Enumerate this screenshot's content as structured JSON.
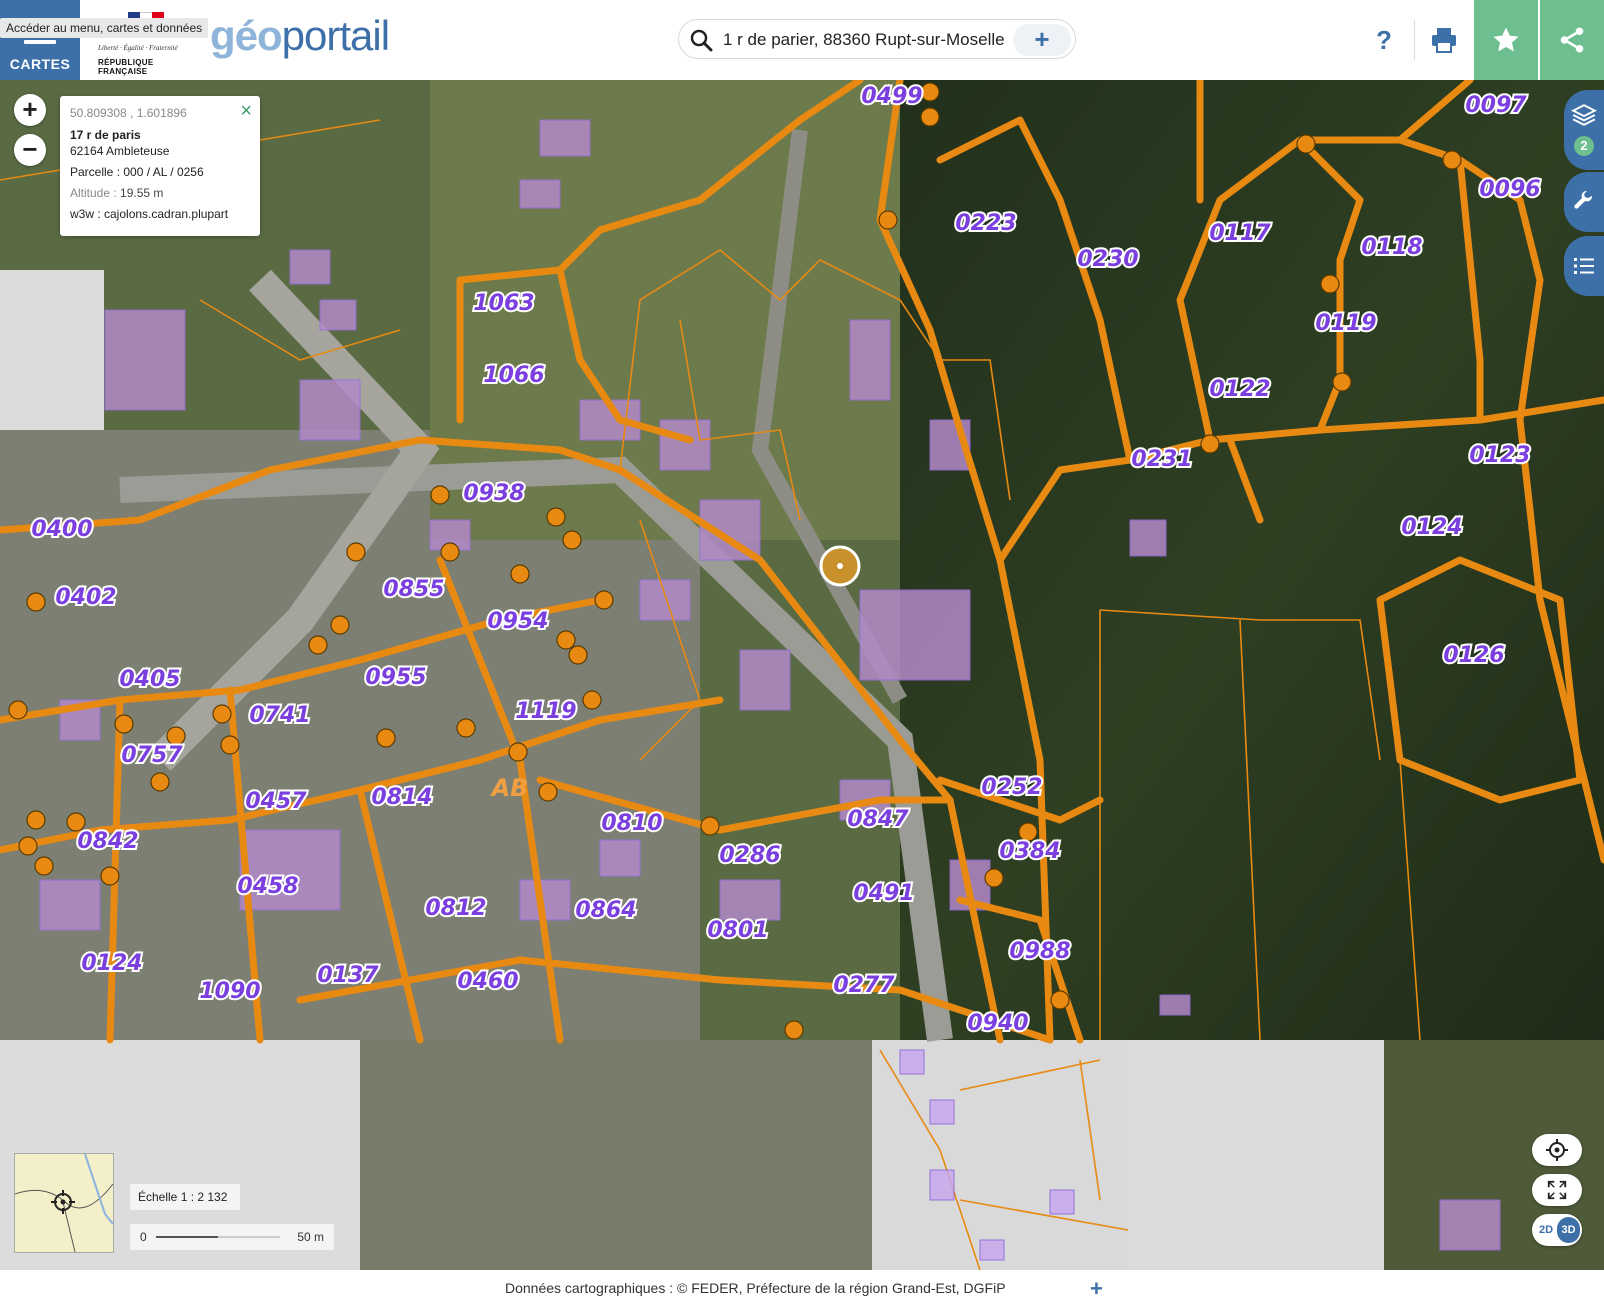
{
  "header": {
    "menu_label": "CARTES",
    "menu_tooltip": "Accéder au menu, cartes et données",
    "marianne_motto": "Liberté · Égalité · Fraternité",
    "marianne_republic": "RÉPUBLIQUE FRANÇAISE",
    "logo_geo": "géo",
    "logo_portail": "portail",
    "search_value": "1 r de parier, 88360 Rupt-sur-Moselle",
    "search_add": "+",
    "help_label": "?",
    "icons": [
      "search-icon",
      "print-icon",
      "star-icon",
      "share-icon"
    ]
  },
  "popup": {
    "coords": "50.809308 , 1.601896",
    "street": "17 r de paris",
    "city": "62164 Ambleteuse",
    "parcel": "Parcelle : 000 / AL / 0256",
    "altitude_label": "Altitude : ",
    "altitude_value": "19.55 m",
    "w3w": "w3w : cajolons.cadran.plupart",
    "close": "×"
  },
  "map_controls": {
    "zoom_in": "+",
    "zoom_out": "−",
    "layers_count": "2",
    "mode_2d": "2D",
    "mode_3d": "3D"
  },
  "parcel_labels": [
    {
      "t": "0499"
    },
    {
      "t": "0097"
    },
    {
      "t": "0223"
    },
    {
      "t": "0096"
    },
    {
      "t": "0230"
    },
    {
      "t": "0117"
    },
    {
      "t": "0118"
    },
    {
      "t": "1063"
    },
    {
      "t": "0119"
    },
    {
      "t": "1066"
    },
    {
      "t": "0122"
    },
    {
      "t": "0231"
    },
    {
      "t": "0123"
    },
    {
      "t": "0938"
    },
    {
      "t": "0124"
    },
    {
      "t": "0400"
    },
    {
      "t": "0402"
    },
    {
      "t": "0855"
    },
    {
      "t": "0954"
    },
    {
      "t": "0126"
    },
    {
      "t": "0405"
    },
    {
      "t": "0955"
    },
    {
      "t": "1119"
    },
    {
      "t": "0741"
    },
    {
      "t": "0757"
    },
    {
      "t": "0457"
    },
    {
      "t": "0814"
    },
    {
      "t": "AB"
    },
    {
      "t": "0810"
    },
    {
      "t": "0847"
    },
    {
      "t": "0252"
    },
    {
      "t": "0842"
    },
    {
      "t": "0286"
    },
    {
      "t": "0384"
    },
    {
      "t": "0458"
    },
    {
      "t": "0812"
    },
    {
      "t": "0864"
    },
    {
      "t": "0491"
    },
    {
      "t": "0801"
    },
    {
      "t": "0988"
    },
    {
      "t": "0124"
    },
    {
      "t": "0137"
    },
    {
      "t": "0460"
    },
    {
      "t": "1090"
    },
    {
      "t": "0277"
    },
    {
      "t": "0940"
    }
  ],
  "scale": {
    "label": "Échelle 1 : 2 132",
    "zero": "0",
    "meters": "50 m"
  },
  "footer": {
    "text": "Données cartographiques : ©    FEDER,  Préfecture de la région Grand-Est,  DGFiP",
    "plus": "+"
  }
}
